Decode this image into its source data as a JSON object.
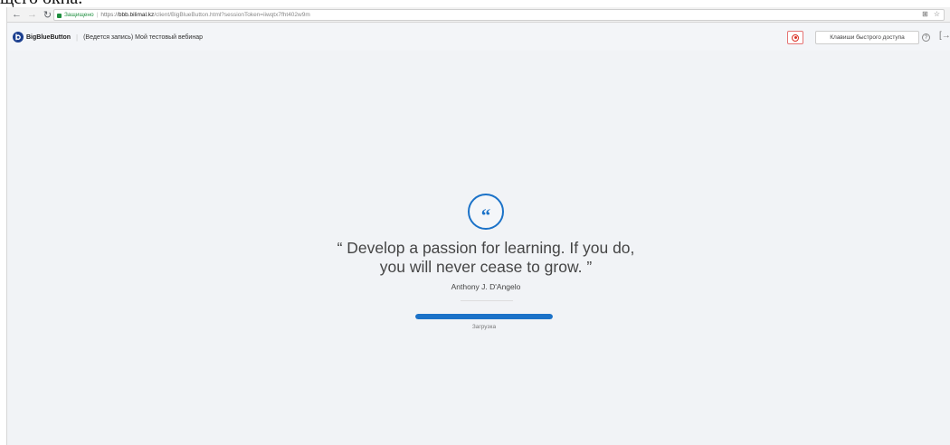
{
  "document_fragment": "щего окна.",
  "browser": {
    "secure_label": "Защищено",
    "url_scheme": "https://",
    "url_host": "bbb.bilimal.kz",
    "url_path": "/client/BigBlueButton.html?sessionToken=iiwqtx7fht402w9m"
  },
  "header": {
    "brand": "BigBlueButton",
    "meeting_title": "(Ведется запись) Мой тестовый вебинар",
    "shortcuts_label": "Клавиши быстрого доступа"
  },
  "loader": {
    "quote_line1": "“ Develop a passion for learning. If you do,",
    "quote_line2": "you will never cease to grow. ”",
    "author": "Anthony J. D'Angelo",
    "loading_label": "Загрузка",
    "progress": 1.0
  },
  "colors": {
    "accent": "#1b72c8",
    "record": "#d93025",
    "secure": "#1e8e3e"
  },
  "icons": [
    "back-icon",
    "forward-icon",
    "reload-icon",
    "lock-icon",
    "translate-icon",
    "star-icon",
    "bigbluebutton-logo",
    "record-icon",
    "help-icon",
    "logout-icon",
    "quote-icon"
  ]
}
